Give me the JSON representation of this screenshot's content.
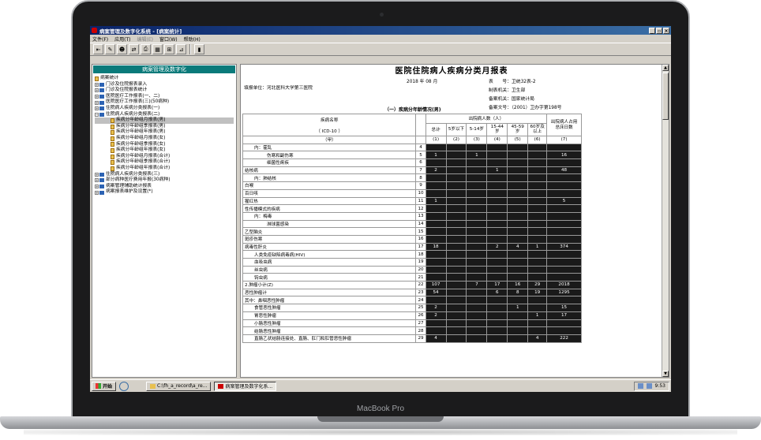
{
  "device": {
    "brand": "MacBook Pro"
  },
  "window": {
    "title": "病案管理及数字化系统 - [病案统计]",
    "controls": [
      "_",
      "▫",
      "×"
    ],
    "menu": [
      "文件(F)",
      "应用(T)",
      "编辑(E)",
      "窗口(W)",
      "帮助(H)"
    ],
    "menu_disabled": [
      false,
      false,
      true,
      false,
      false
    ]
  },
  "toolbar": {
    "icons": [
      "exit-icon",
      "edit-icon",
      "user-icon",
      "link-icon",
      "print-icon",
      "grid-icon",
      "table-icon",
      "chart-icon",
      "door-icon"
    ]
  },
  "sidebar": {
    "title": "病案管理及数字化",
    "root": "病案统计",
    "items": [
      {
        "label": "门诊及住院报表录入",
        "level": 1,
        "type": "folder"
      },
      {
        "label": "门诊及住院报表统计",
        "level": 1,
        "type": "folder"
      },
      {
        "label": "医院医疗工作报表(一、二)",
        "level": 1,
        "type": "folder"
      },
      {
        "label": "医院医疗工作报表(三)(50病种)",
        "level": 1,
        "type": "folder"
      },
      {
        "label": "住院病人疾病分类报表(一)",
        "level": 1,
        "type": "folder"
      },
      {
        "label": "住院病人疾病分类报表(二)",
        "level": 1,
        "type": "folder-open"
      },
      {
        "label": "疾病分年龄组月报表(男)",
        "level": 2,
        "type": "doc",
        "selected": true
      },
      {
        "label": "疾病分年龄组季报表(男)",
        "level": 2,
        "type": "doc"
      },
      {
        "label": "疾病分年龄组年报表(男)",
        "level": 2,
        "type": "doc"
      },
      {
        "label": "疾病分年龄组月报表(女)",
        "level": 2,
        "type": "doc"
      },
      {
        "label": "疾病分年龄组季报表(女)",
        "level": 2,
        "type": "doc"
      },
      {
        "label": "疾病分年龄组年报表(女)",
        "level": 2,
        "type": "doc"
      },
      {
        "label": "疾病分年龄组月报表(合计)",
        "level": 2,
        "type": "doc"
      },
      {
        "label": "疾病分年龄组季报表(合计)",
        "level": 2,
        "type": "doc"
      },
      {
        "label": "疾病分年龄组年报表(合计)",
        "level": 2,
        "type": "doc"
      },
      {
        "label": "住院病人疾病分类报表(三)",
        "level": 1,
        "type": "folder"
      },
      {
        "label": "部分病种医疗费用年报(30病种)",
        "level": 1,
        "type": "folder"
      },
      {
        "label": "病案管理辅助统计报表",
        "level": 1,
        "type": "folder"
      },
      {
        "label": "病案报表维护及设置(*)",
        "level": 1,
        "type": "folder"
      }
    ]
  },
  "report": {
    "title": "医院住院病人疾病分类月报表",
    "unit": "填报单位：河北医科大学第三医院",
    "period": "2018 年 08 月",
    "form_no": "表　　号：卫统32表-2",
    "org": "制表机关：卫生部",
    "approver": "备案机关：国家统计局",
    "doc_no": "备案文号：（2001）卫办字第198号",
    "subtitle": "（一）疾病分年龄情况(男)",
    "headers": {
      "disease": "疾病名称",
      "icd": "（ ICD-10 ）",
      "jia": "（甲）",
      "age_group": "出院病人数（人）",
      "total": "总计",
      "c1": "5岁以下",
      "c2": "5-14岁",
      "c3": "15-44岁",
      "c4": "45-59岁",
      "c5": "60岁及以上",
      "days": "出院病人占用总床日数",
      "nums": [
        "(1)",
        "(2)",
        "(3)",
        "(4)",
        "(5)",
        "(6)",
        "(7)"
      ]
    },
    "rows": [
      {
        "name": "内：霍乱",
        "ind": 1,
        "no": "4",
        "v": [
          "",
          "",
          "",
          "",
          "",
          "",
          ""
        ]
      },
      {
        "name": "伤寒和副伤寒",
        "ind": 2,
        "no": "5",
        "v": [
          "1",
          "",
          "1",
          "",
          "",
          "",
          "16"
        ]
      },
      {
        "name": "细菌性痢疾",
        "ind": 2,
        "no": "6",
        "v": [
          "",
          "",
          "",
          "",
          "",
          "",
          ""
        ]
      },
      {
        "name": "结核病",
        "ind": 0,
        "no": "7",
        "v": [
          "2",
          "",
          "",
          "1",
          "",
          "",
          "48"
        ]
      },
      {
        "name": "内：肺结核",
        "ind": 1,
        "no": "8",
        "v": [
          "",
          "",
          "",
          "",
          "",
          "",
          ""
        ]
      },
      {
        "name": "白喉",
        "ind": 0,
        "no": "9",
        "v": [
          "",
          "",
          "",
          "",
          "",
          "",
          ""
        ]
      },
      {
        "name": "百日咳",
        "ind": 0,
        "no": "10",
        "v": [
          "",
          "",
          "",
          "",
          "",
          "",
          ""
        ]
      },
      {
        "name": "猩红热",
        "ind": 0,
        "no": "11",
        "v": [
          "1",
          "",
          "",
          "",
          "",
          "",
          "5"
        ]
      },
      {
        "name": "性传播模式的疾病",
        "ind": 0,
        "no": "12",
        "v": [
          "",
          "",
          "",
          "",
          "",
          "",
          ""
        ]
      },
      {
        "name": "内：梅毒",
        "ind": 1,
        "no": "13",
        "v": [
          "",
          "",
          "",
          "",
          "",
          "",
          ""
        ]
      },
      {
        "name": "淋球菌感染",
        "ind": 2,
        "no": "14",
        "v": [
          "",
          "",
          "",
          "",
          "",
          "",
          ""
        ]
      },
      {
        "name": "乙型脑炎",
        "ind": 0,
        "no": "15",
        "v": [
          "",
          "",
          "",
          "",
          "",
          "",
          ""
        ]
      },
      {
        "name": "斑疹伤寒",
        "ind": 0,
        "no": "16",
        "v": [
          "",
          "",
          "",
          "",
          "",
          "",
          ""
        ]
      },
      {
        "name": "病毒性肝炎",
        "ind": 0,
        "no": "17",
        "v": [
          "18",
          "",
          "",
          "2",
          "4",
          "1",
          "374"
        ]
      },
      {
        "name": "人类免疫缺陷病毒病(HIV)",
        "ind": 1,
        "no": "18",
        "v": [
          "",
          "",
          "",
          "",
          "",
          "",
          ""
        ]
      },
      {
        "name": "血吸虫病",
        "ind": 1,
        "no": "19",
        "v": [
          "",
          "",
          "",
          "",
          "",
          "",
          ""
        ]
      },
      {
        "name": "丝虫病",
        "ind": 1,
        "no": "20",
        "v": [
          "",
          "",
          "",
          "",
          "",
          "",
          ""
        ]
      },
      {
        "name": "钩虫病",
        "ind": 1,
        "no": "21",
        "v": [
          "",
          "",
          "",
          "",
          "",
          "",
          ""
        ]
      },
      {
        "name": "2.肿瘤小计(Z)",
        "ind": 0,
        "no": "22",
        "v": [
          "107",
          "",
          "7",
          "17",
          "16",
          "29",
          "2018"
        ]
      },
      {
        "name": "恶性肿瘤计",
        "ind": 0,
        "no": "23",
        "v": [
          "54",
          "",
          "",
          "6",
          "8",
          "19",
          "1295"
        ]
      },
      {
        "name": "其中：鼻咽恶性肿瘤",
        "ind": 0,
        "no": "24",
        "v": [
          "",
          "",
          "",
          "",
          "",
          "",
          ""
        ]
      },
      {
        "name": "食管恶性肿瘤",
        "ind": 1,
        "no": "25",
        "v": [
          "2",
          "",
          "",
          "",
          "1",
          "",
          "15"
        ]
      },
      {
        "name": "胃恶性肿瘤",
        "ind": 1,
        "no": "26",
        "v": [
          "2",
          "",
          "",
          "",
          "",
          "1",
          "17"
        ]
      },
      {
        "name": "小肠恶性肿瘤",
        "ind": 1,
        "no": "27",
        "v": [
          "",
          "",
          "",
          "",
          "",
          "",
          ""
        ]
      },
      {
        "name": "结肠恶性肿瘤",
        "ind": 1,
        "no": "28",
        "v": [
          "",
          "",
          "",
          "",
          "",
          "",
          ""
        ]
      },
      {
        "name": "直肠乙状结肠连接处、直肠、肛门和肛管恶性肿瘤",
        "ind": 1,
        "no": "29",
        "v": [
          "4",
          "",
          "",
          "",
          "",
          "4",
          "222"
        ]
      }
    ]
  },
  "taskbar": {
    "start": "开始",
    "tasks": [
      "C:\\fh_a_record\\a_re...",
      "病案管理及数字化系..."
    ],
    "clock": "9:53"
  }
}
